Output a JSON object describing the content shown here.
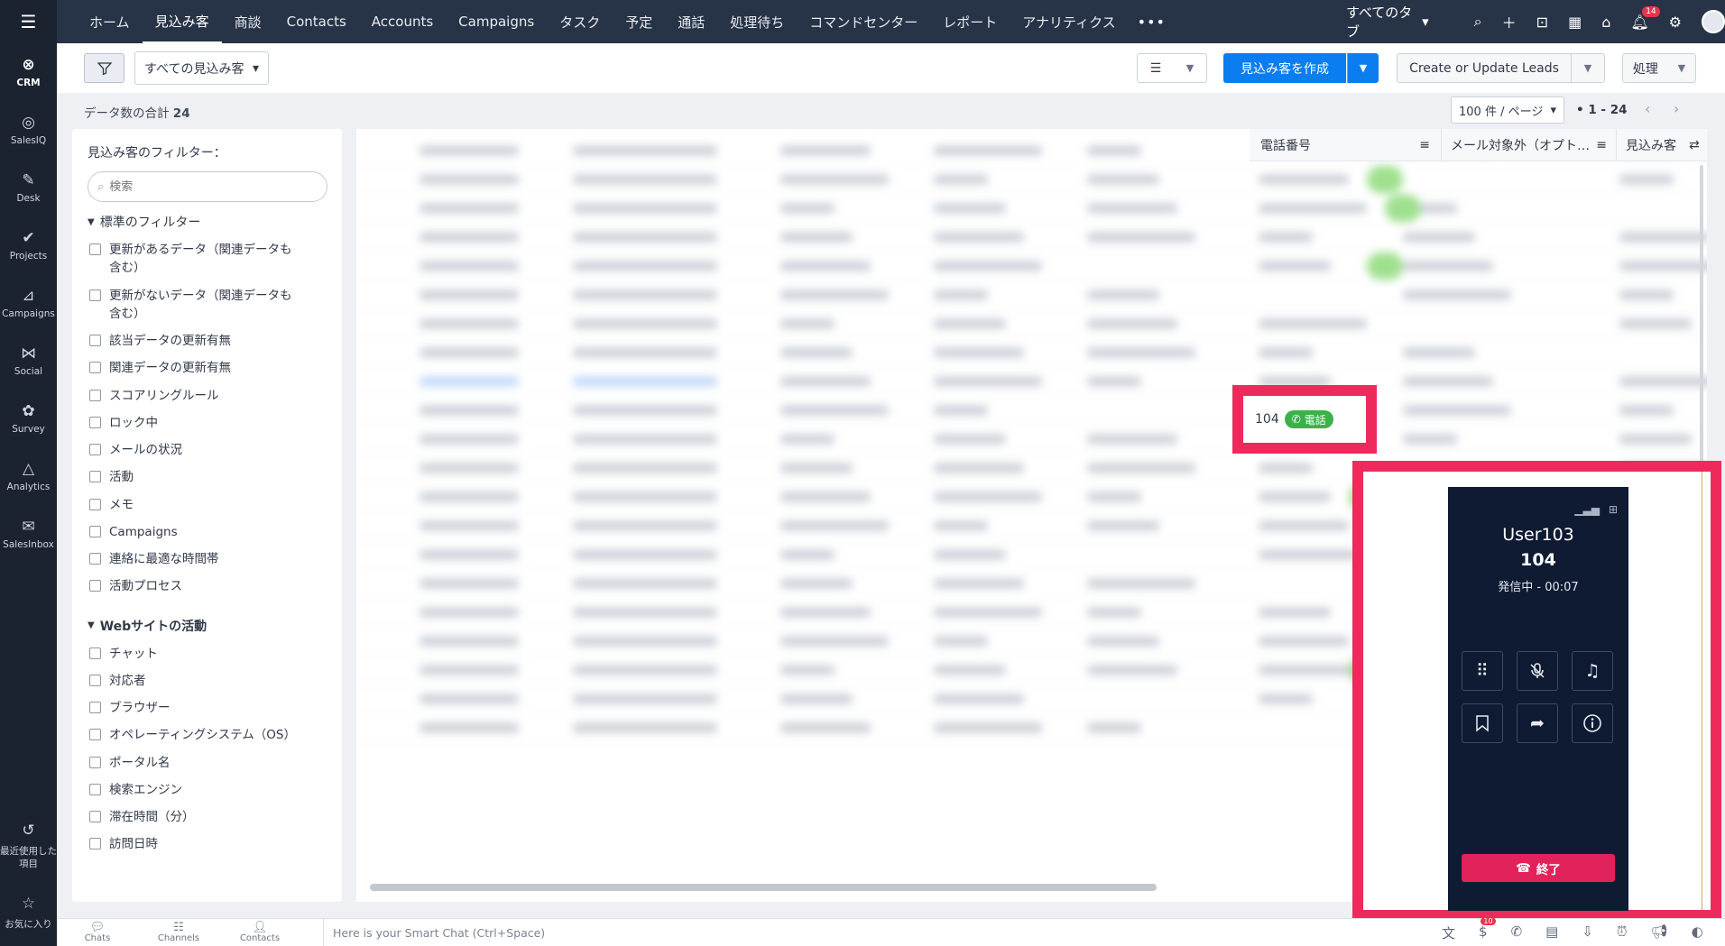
{
  "rail": {
    "items": [
      {
        "label": "CRM",
        "icon": "crm-icon",
        "glyph": "⊗"
      },
      {
        "label": "SalesIQ",
        "icon": "salesiq-icon",
        "glyph": "◎"
      },
      {
        "label": "Desk",
        "icon": "desk-icon",
        "glyph": "✎"
      },
      {
        "label": "Projects",
        "icon": "projects-icon",
        "glyph": "✔"
      },
      {
        "label": "Campaigns",
        "icon": "campaigns-icon",
        "glyph": "⊿"
      },
      {
        "label": "Social",
        "icon": "social-icon",
        "glyph": "⋈"
      },
      {
        "label": "Survey",
        "icon": "survey-icon",
        "glyph": "✿"
      },
      {
        "label": "Analytics",
        "icon": "analytics-icon",
        "glyph": "△"
      },
      {
        "label": "SalesInbox",
        "icon": "salesinbox-icon",
        "glyph": "✉"
      }
    ],
    "bottom": [
      {
        "label": "最近使用した項目",
        "icon": "history-icon",
        "glyph": "↺"
      },
      {
        "label": "お気に入り",
        "icon": "star-icon",
        "glyph": "☆"
      }
    ]
  },
  "topbar": {
    "tabs": [
      "ホーム",
      "見込み客",
      "商談",
      "Contacts",
      "Accounts",
      "Campaigns",
      "タスク",
      "予定",
      "通話",
      "処理待ち",
      "コマンドセンター",
      "レポート",
      "アナリティクス"
    ],
    "active_tab": "見込み客",
    "more": "•••",
    "all_tabs": "すべてのタブ",
    "notification_count": "14"
  },
  "toolbar": {
    "view_select": "すべての見込み客",
    "create_label": "見込み客を作成",
    "update_label": "Create or Update Leads",
    "action_label": "処理"
  },
  "summary": {
    "total_label": "データ数の合計",
    "total_count": "24",
    "per_page": "100 件 / ページ",
    "range": "1 - 24"
  },
  "filters": {
    "title": "見込み客のフィルター：",
    "search_placeholder": "検索",
    "standard_head": "標準のフィルター",
    "standard": [
      "更新があるデータ（関連データも含む）",
      "更新がないデータ（関連データも含む）",
      "該当データの更新有無",
      "関連データの更新有無",
      "スコアリングルール",
      "ロック中",
      "メールの状況",
      "活動",
      "メモ",
      "Campaigns",
      "連絡に最適な時間帯",
      "活動プロセス"
    ],
    "web_head": "Webサイトの活動",
    "web": [
      "チャット",
      "対応者",
      "ブラウザー",
      "オペレーティングシステム（OS）",
      "ポータル名",
      "検索エンジン",
      "滞在時間（分）",
      "訪問日時"
    ]
  },
  "table": {
    "columns": [
      "電話番号",
      "メール対象外（オプト…",
      "見込み客"
    ],
    "highlight_number": "104",
    "call_label": "電話"
  },
  "softphone": {
    "user": "User103",
    "number": "104",
    "status": "発信中 - 00:07",
    "end_label": "終了"
  },
  "bottombar": {
    "items": [
      "Chats",
      "Channels",
      "Contacts"
    ],
    "smart_chat": "Here is your Smart Chat (Ctrl+Space)",
    "badge": "10"
  },
  "colors": {
    "topbar": "#273346",
    "rail": "#1c2330",
    "primary": "#0a7ef0",
    "highlight": "#ee2a5c",
    "call_green": "#3cb14a",
    "phone_bg": "#0f1b33",
    "end_red": "#e2235b"
  }
}
